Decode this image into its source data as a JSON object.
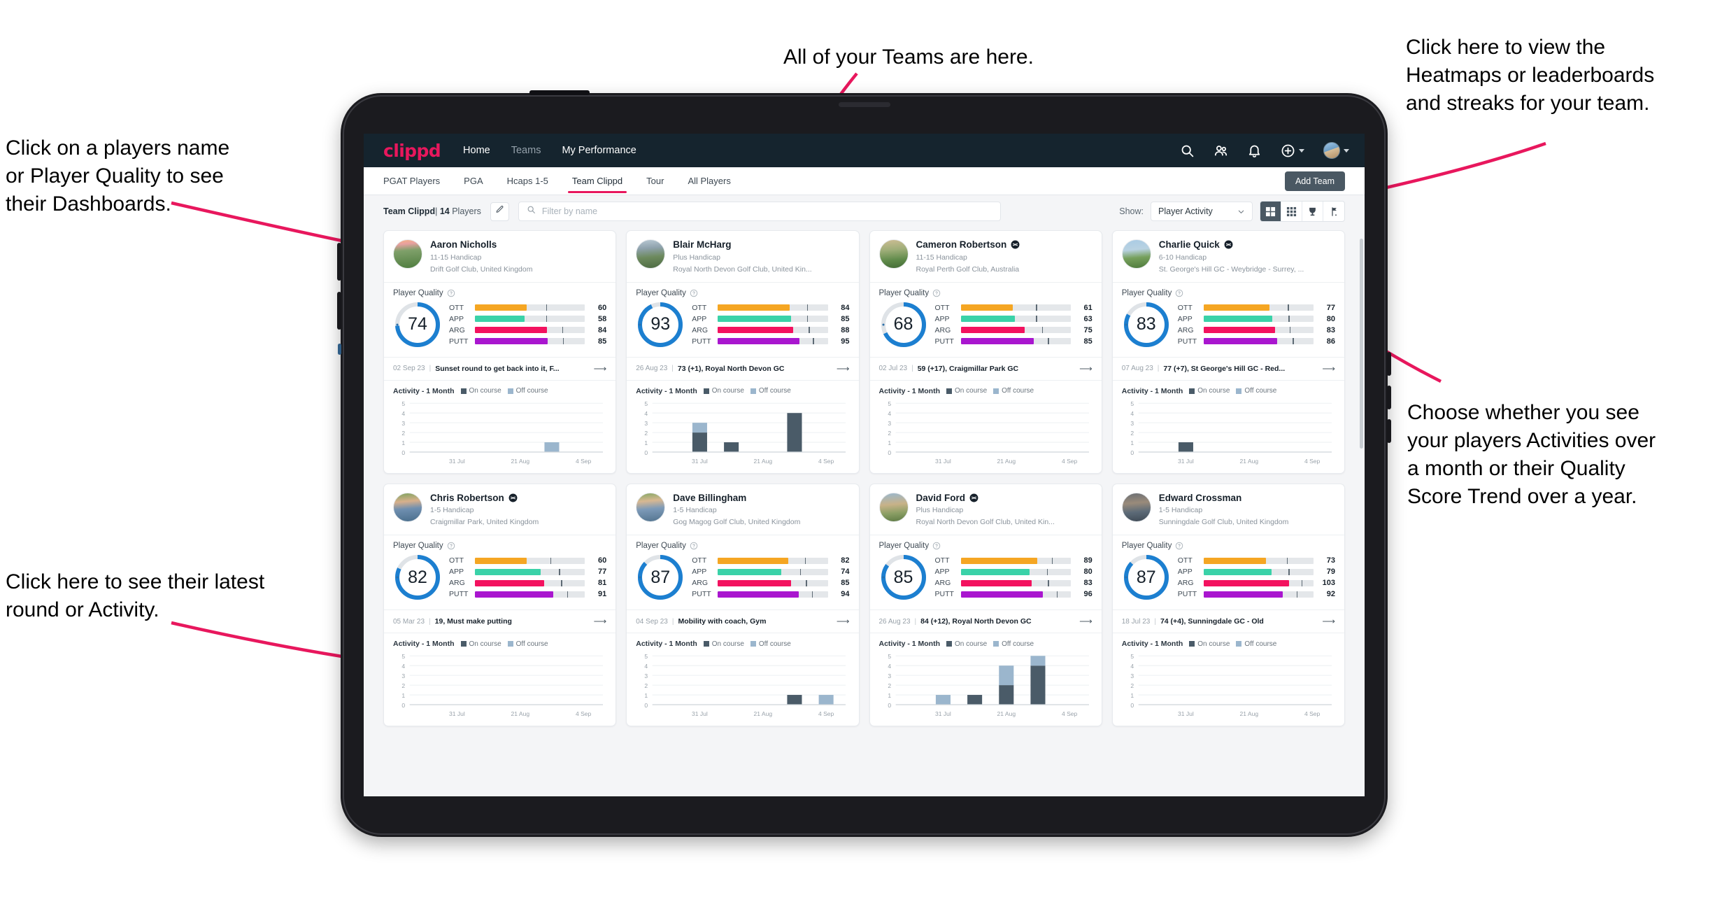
{
  "annotations": [
    {
      "id": "teams",
      "text": "All of your Teams are here."
    },
    {
      "id": "heatmaps",
      "text": "Click here to view the\nHeatmaps or leaderboards\nand streaks for your team."
    },
    {
      "id": "playername",
      "text": "Click on a players name\nor Player Quality to see\ntheir Dashboards."
    },
    {
      "id": "showmode",
      "text": "Choose whether you see\nyour players Activities over\na month or their Quality\nScore Trend over a year."
    },
    {
      "id": "latest",
      "text": "Click here to see their latest\nround or Activity."
    }
  ],
  "colors": {
    "brand": "#e8175d",
    "navbar": "#15242e",
    "ring": "#1c7fd0",
    "ott": "#f5a623",
    "app": "#3ad2a8",
    "arg": "#f3125f",
    "putt": "#a916cf",
    "on_course": "#4a5b68",
    "off_course": "#9bb6cd",
    "annotation_arrow": "#e8175d"
  },
  "topnav": {
    "logo": "clippd",
    "links": [
      {
        "label": "Home",
        "active": true
      },
      {
        "label": "Teams",
        "active": false
      },
      {
        "label": "My Performance",
        "active": true
      }
    ],
    "icons": [
      "search-icon",
      "people-icon",
      "bell-icon",
      "plus-circle-icon",
      "avatar"
    ]
  },
  "subnav": {
    "tabs": [
      {
        "label": "PGAT Players",
        "active": false
      },
      {
        "label": "PGA",
        "active": false
      },
      {
        "label": "Hcaps 1-5",
        "active": false
      },
      {
        "label": "Team Clippd",
        "active": true
      },
      {
        "label": "Tour",
        "active": false
      },
      {
        "label": "All Players",
        "active": false
      }
    ],
    "add_team_label": "Add Team"
  },
  "toolbar": {
    "team_name": "Team Clippd",
    "player_count": "14",
    "players_word": "Players",
    "separator": "|",
    "edit_icon": "pencil-icon",
    "search_placeholder": "Filter by name",
    "search_value": "",
    "show_label": "Show:",
    "show_value": "Player Activity",
    "show_options": [
      "Player Activity",
      "Quality Score Trend"
    ],
    "view_modes": [
      {
        "name": "grid-view",
        "icon": "grid-large-icon",
        "active": true
      },
      {
        "name": "compact-view",
        "icon": "grid-small-icon",
        "active": false
      },
      {
        "name": "leaderboard-view",
        "icon": "trophy-icon",
        "active": false
      },
      {
        "name": "course-view",
        "icon": "golf-flag-icon",
        "active": false
      }
    ]
  },
  "card_labels": {
    "player_quality": "Player Quality",
    "help_icon": "question-circle-icon",
    "activity_title": "Activity - 1 Month",
    "legend_on": "On course",
    "legend_off": "Off course",
    "arrow_icon": "arrow-right-icon",
    "verified_icon": "verified-badge-icon",
    "metric_labels": [
      "OTT",
      "APP",
      "ARG",
      "PUTT"
    ],
    "y_ticks": [
      "5",
      "4",
      "3",
      "2",
      "1",
      "0"
    ],
    "x_ticks": [
      "31 Jul",
      "21 Aug",
      "4 Sep"
    ]
  },
  "players": [
    {
      "name": "Aaron Nicholls",
      "verified": false,
      "handicap": "11-15 Handicap",
      "club": "Drift Golf Club, United Kingdom",
      "quality": 74,
      "metrics": [
        {
          "label": "OTT",
          "value": 60,
          "tick": 72
        },
        {
          "label": "APP",
          "value": 58,
          "tick": 72
        },
        {
          "label": "ARG",
          "value": 84,
          "tick": 88
        },
        {
          "label": "PUTT",
          "value": 85,
          "tick": 89
        }
      ],
      "latest_date": "02 Sep 23",
      "latest_text": "Sunset round to get back into it, F...",
      "avatar_css": "linear-gradient(175deg,#f4b183 0%,#e8a0a0 16%,#7fa06a 38%,#4f7d3f 100%)",
      "activity": [
        {
          "on": 0,
          "off": 0
        },
        {
          "on": 0,
          "off": 0
        },
        {
          "on": 0,
          "off": 0
        },
        {
          "on": 0,
          "off": 0
        },
        {
          "on": 0,
          "off": 1
        },
        {
          "on": 0,
          "off": 0
        }
      ]
    },
    {
      "name": "Blair McHarg",
      "verified": false,
      "handicap": "Plus Handicap",
      "club": "Royal North Devon Golf Club, United Kin...",
      "quality": 93,
      "metrics": [
        {
          "label": "OTT",
          "value": 84,
          "tick": 90
        },
        {
          "label": "APP",
          "value": 85,
          "tick": 90
        },
        {
          "label": "ARG",
          "value": 88,
          "tick": 92
        },
        {
          "label": "PUTT",
          "value": 95,
          "tick": 96
        }
      ],
      "latest_date": "26 Aug 23",
      "latest_text": "73 (+1), Royal North Devon GC",
      "avatar_css": "linear-gradient(175deg,#b9c9d4 0%,#8fa2ad 30%,#6d8a5e 60%,#4d6b42 100%)",
      "activity": [
        {
          "on": 0,
          "off": 0
        },
        {
          "on": 2,
          "off": 1
        },
        {
          "on": 1,
          "off": 0
        },
        {
          "on": 0,
          "off": 0
        },
        {
          "on": 4,
          "off": 0
        },
        {
          "on": 0,
          "off": 0
        }
      ]
    },
    {
      "name": "Cameron Robertson",
      "verified": true,
      "handicap": "11-15 Handicap",
      "club": "Royal Perth Golf Club, Australia",
      "quality": 68,
      "metrics": [
        {
          "label": "OTT",
          "value": 61,
          "tick": 76
        },
        {
          "label": "APP",
          "value": 63,
          "tick": 76
        },
        {
          "label": "ARG",
          "value": 75,
          "tick": 82
        },
        {
          "label": "PUTT",
          "value": 85,
          "tick": 88
        }
      ],
      "latest_date": "02 Jul 23",
      "latest_text": "59 (+17), Craigmillar Park GC",
      "avatar_css": "linear-gradient(175deg,#cdbd94 0%,#9fae79 35%,#5f8a4a 70%,#436b36 100%)",
      "activity": [
        {
          "on": 0,
          "off": 0
        },
        {
          "on": 0,
          "off": 0
        },
        {
          "on": 0,
          "off": 0
        },
        {
          "on": 0,
          "off": 0
        },
        {
          "on": 0,
          "off": 0
        },
        {
          "on": 0,
          "off": 0
        }
      ]
    },
    {
      "name": "Charlie Quick",
      "verified": true,
      "handicap": "6-10 Handicap",
      "club": "St. George's Hill GC - Weybridge - Surrey, ...",
      "quality": 83,
      "metrics": [
        {
          "label": "OTT",
          "value": 77,
          "tick": 85
        },
        {
          "label": "APP",
          "value": 80,
          "tick": 86
        },
        {
          "label": "ARG",
          "value": 83,
          "tick": 87
        },
        {
          "label": "PUTT",
          "value": 86,
          "tick": 90
        }
      ],
      "latest_date": "07 Aug 23",
      "latest_text": "77 (+7), St George's Hill GC - Red...",
      "avatar_css": "linear-gradient(175deg,#a9cbe4 0%,#b9d2e2 35%,#76a05c 62%,#4e7a3c 100%)",
      "activity": [
        {
          "on": 0,
          "off": 0
        },
        {
          "on": 1,
          "off": 0
        },
        {
          "on": 0,
          "off": 0
        },
        {
          "on": 0,
          "off": 0
        },
        {
          "on": 0,
          "off": 0
        },
        {
          "on": 0,
          "off": 0
        }
      ]
    },
    {
      "name": "Chris Robertson",
      "verified": true,
      "handicap": "1-5 Handicap",
      "club": "Craigmillar Park, United Kingdom",
      "quality": 82,
      "metrics": [
        {
          "label": "OTT",
          "value": 60,
          "tick": 76
        },
        {
          "label": "APP",
          "value": 77,
          "tick": 85
        },
        {
          "label": "ARG",
          "value": 81,
          "tick": 87
        },
        {
          "label": "PUTT",
          "value": 91,
          "tick": 93
        }
      ],
      "latest_date": "05 Mar 23",
      "latest_text": "19, Must make putting",
      "avatar_css": "linear-gradient(175deg,#7fa35e 0%,#d8b08c 30%,#6f8fb0 55%,#4a6e8c 100%)",
      "activity": [
        {
          "on": 0,
          "off": 0
        },
        {
          "on": 0,
          "off": 0
        },
        {
          "on": 0,
          "off": 0
        },
        {
          "on": 0,
          "off": 0
        },
        {
          "on": 0,
          "off": 0
        },
        {
          "on": 0,
          "off": 0
        }
      ]
    },
    {
      "name": "Dave Billingham",
      "verified": false,
      "handicap": "1-5 Handicap",
      "club": "Gog Magog Golf Club, United Kingdom",
      "quality": 87,
      "metrics": [
        {
          "label": "OTT",
          "value": 82,
          "tick": 88
        },
        {
          "label": "APP",
          "value": 74,
          "tick": 83
        },
        {
          "label": "ARG",
          "value": 85,
          "tick": 89
        },
        {
          "label": "PUTT",
          "value": 94,
          "tick": 95
        }
      ],
      "latest_date": "04 Sep 23",
      "latest_text": "Mobility with coach, Gym",
      "avatar_css": "linear-gradient(175deg,#86a864 0%,#d9b892 28%,#7d9ab8 55%,#53748f 100%)",
      "activity": [
        {
          "on": 0,
          "off": 0
        },
        {
          "on": 0,
          "off": 0
        },
        {
          "on": 0,
          "off": 0
        },
        {
          "on": 0,
          "off": 0
        },
        {
          "on": 1,
          "off": 0
        },
        {
          "on": 0,
          "off": 1
        }
      ]
    },
    {
      "name": "David Ford",
      "verified": true,
      "handicap": "Plus Handicap",
      "club": "Royal North Devon Golf Club, United Kin...",
      "quality": 85,
      "metrics": [
        {
          "label": "OTT",
          "value": 89,
          "tick": 92
        },
        {
          "label": "APP",
          "value": 80,
          "tick": 87
        },
        {
          "label": "ARG",
          "value": 83,
          "tick": 88
        },
        {
          "label": "PUTT",
          "value": 96,
          "tick": 97
        }
      ],
      "latest_date": "26 Aug 23",
      "latest_text": "84 (+12), Royal North Devon GC",
      "avatar_css": "linear-gradient(175deg,#9ab8cf 0%,#c8b288 40%,#8a9e64 70%,#5e7a44 100%)",
      "activity": [
        {
          "on": 0,
          "off": 0
        },
        {
          "on": 0,
          "off": 1
        },
        {
          "on": 1,
          "off": 0
        },
        {
          "on": 2,
          "off": 2
        },
        {
          "on": 4,
          "off": 1
        },
        {
          "on": 0,
          "off": 0
        }
      ]
    },
    {
      "name": "Edward Crossman",
      "verified": false,
      "handicap": "1-5 Handicap",
      "club": "Sunningdale Golf Club, United Kingdom",
      "quality": 87,
      "metrics": [
        {
          "label": "OTT",
          "value": 73,
          "tick": 84
        },
        {
          "label": "APP",
          "value": 79,
          "tick": 86
        },
        {
          "label": "ARG",
          "value": 103,
          "tick": 99
        },
        {
          "label": "PUTT",
          "value": 92,
          "tick": 94
        }
      ],
      "latest_date": "18 Jul 23",
      "latest_text": "74 (+4), Sunningdale GC - Old",
      "avatar_css": "linear-gradient(175deg,#6b6f74 0%,#9a8b7a 35%,#5d6b78 65%,#3f4a55 100%)",
      "activity": [
        {
          "on": 0,
          "off": 0
        },
        {
          "on": 0,
          "off": 0
        },
        {
          "on": 0,
          "off": 0
        },
        {
          "on": 0,
          "off": 0
        },
        {
          "on": 0,
          "off": 0
        },
        {
          "on": 0,
          "off": 0
        }
      ]
    }
  ]
}
